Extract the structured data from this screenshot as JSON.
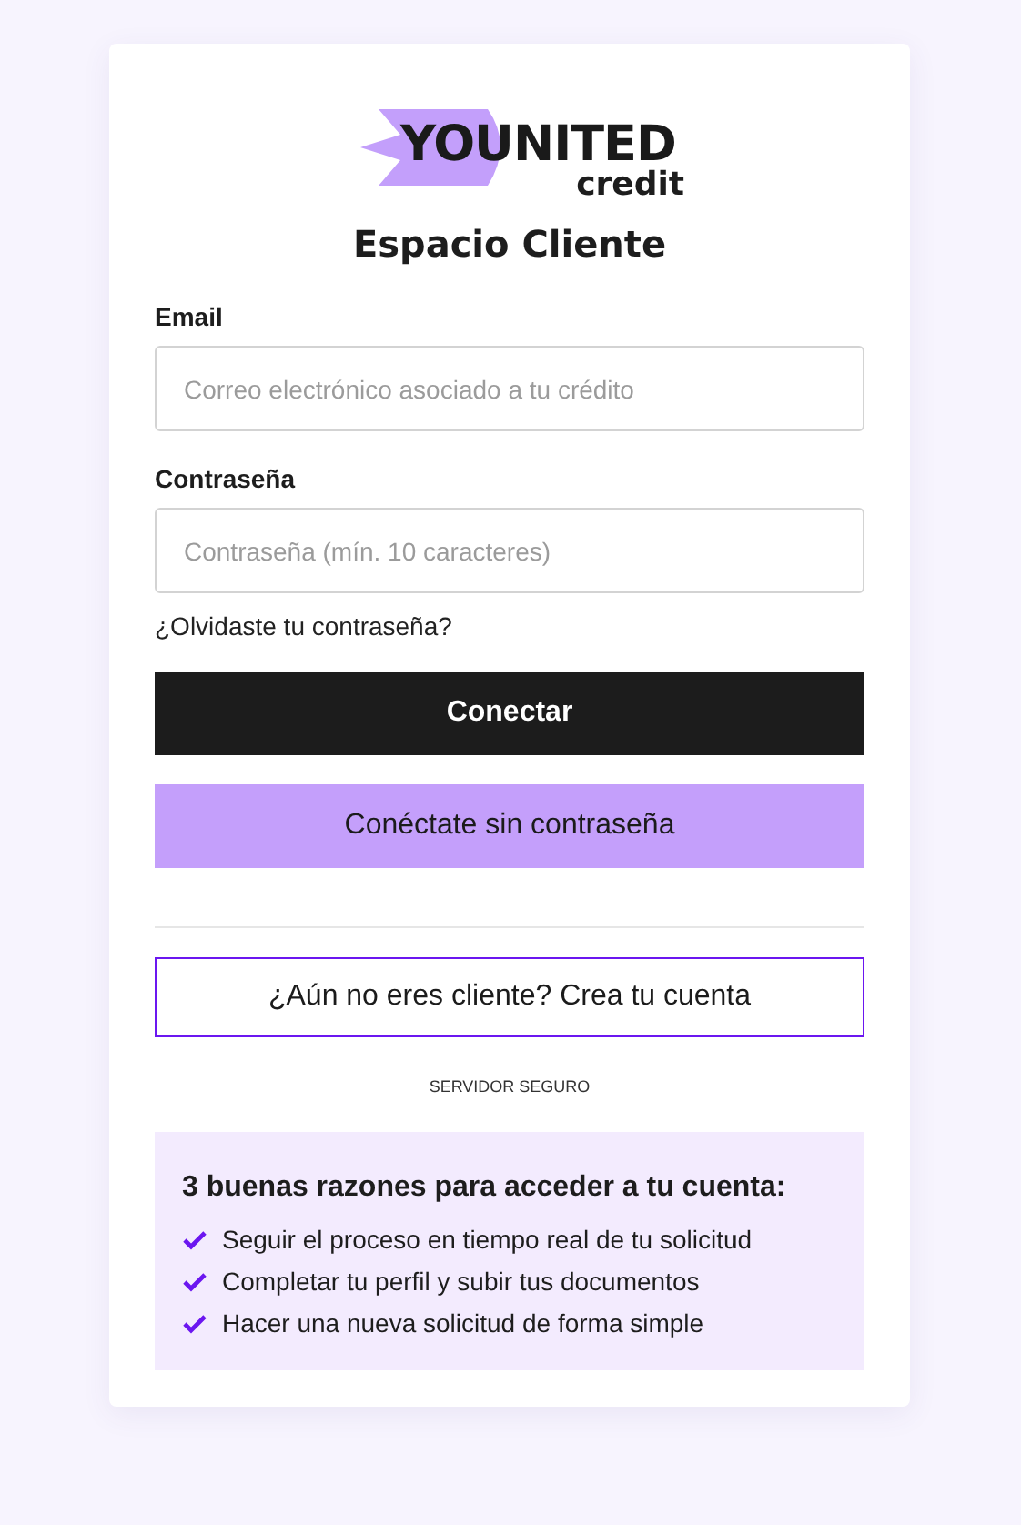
{
  "logo": {
    "wordmark": "YOUNITED",
    "sub": "credit"
  },
  "title": "Espacio Cliente",
  "fields": [
    {
      "label": "Email",
      "placeholder": "Correo electrónico asociado a tu crédito"
    },
    {
      "label": "Contraseña",
      "placeholder": "Contraseña (mín. 10 caracteres)"
    }
  ],
  "forgot_link": "¿Olvidaste tu contraseña?",
  "buttons": [
    {
      "kind": "primary",
      "label": "Conectar"
    },
    {
      "kind": "secondary",
      "label": "Conéctate sin contraseña"
    }
  ],
  "signup_button": "¿Aún no eres cliente? Crea tu cuenta",
  "secure_note": "SERVIDOR SEGURO",
  "reasons": {
    "title": "3 buenas razones para acceder a tu cuenta:",
    "items": [
      "Seguir el proceso en tiempo real de tu solicitud",
      "Completar tu perfil y subir tus documentos",
      "Hacer una nueva solicitud de forma simple"
    ]
  }
}
